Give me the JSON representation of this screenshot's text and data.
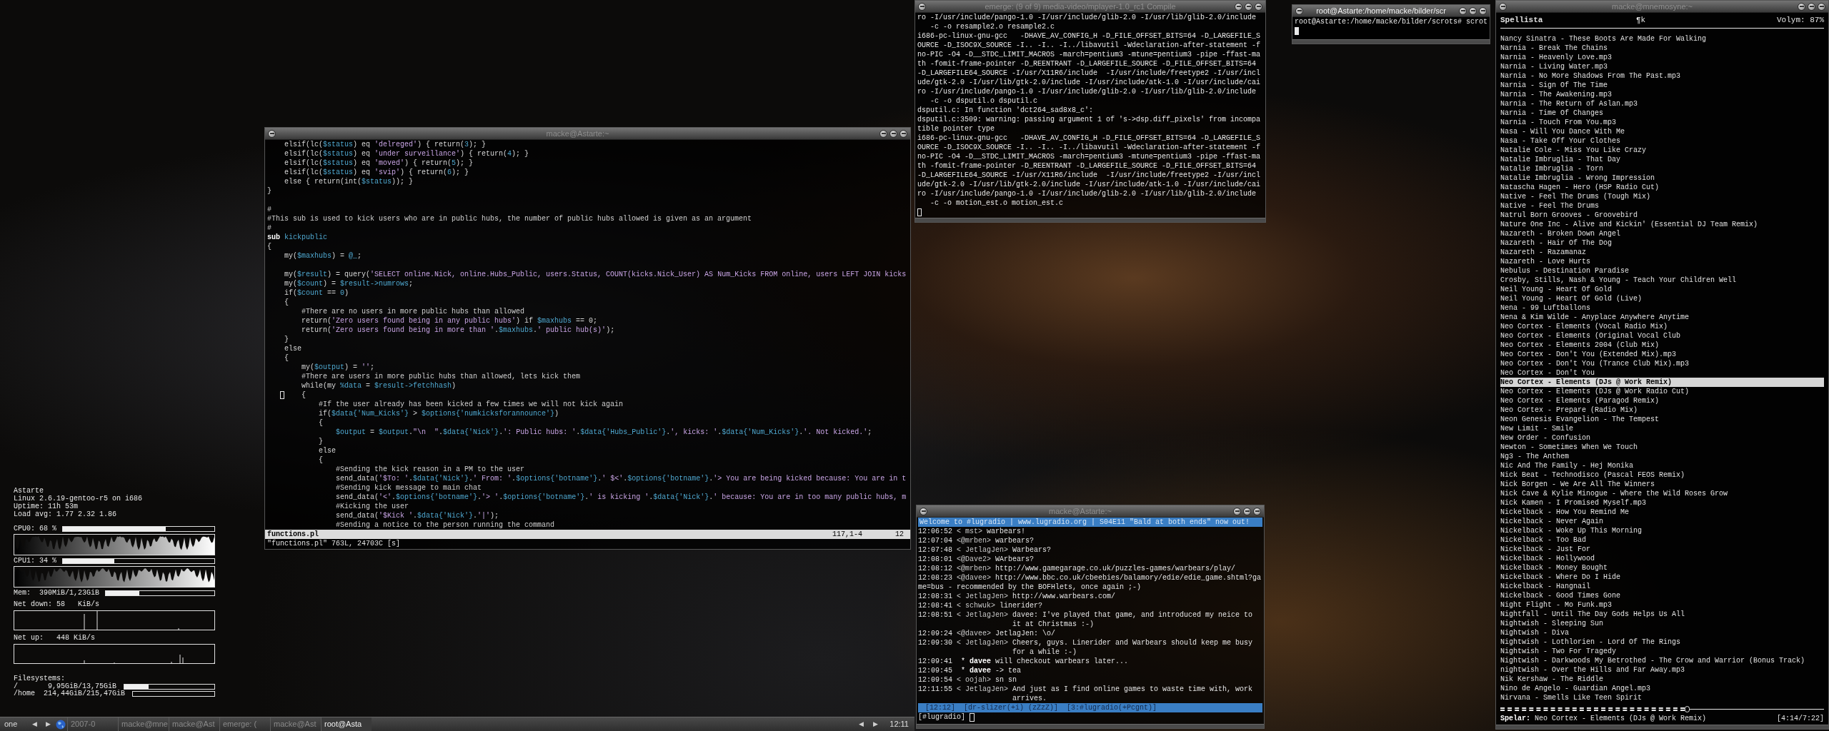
{
  "system_monitor": {
    "lines": [
      "Astarte",
      "Linux 2.6.19-gentoo-r5 on i686",
      "Uptime: 11h 53m",
      "Load avg: 1.77 2.32 1.86"
    ],
    "cpus": [
      {
        "label": "CPU0: 68 %",
        "level": 0.68
      },
      {
        "label": "CPU1: 34 %",
        "level": 0.34
      }
    ],
    "memory": {
      "label": "Mem:  390MiB/1,23GiB",
      "level": 0.31
    },
    "network": [
      {
        "label": "Net down: 58   KiB/s"
      },
      {
        "label": "Net up:   448 KiB/s"
      }
    ],
    "filesystems": {
      "title": "Filesystems:",
      "items": [
        {
          "label": "/       9,95GiB/13,75GiB",
          "level": 0.27
        },
        {
          "label": "/home  214,44GiB/215,47GiB",
          "level": 0
        }
      ]
    }
  },
  "editor": {
    "title": "macke@Astarte:~",
    "focused": false,
    "lines": [
      {
        "kind": "code",
        "segments": [
          {
            "kind": "plain",
            "text": "    elsif(lc("
          },
          {
            "kind": "var",
            "text": "$status"
          },
          {
            "kind": "plain",
            "text": ") eq "
          },
          {
            "kind": "string",
            "text": "'delreged'"
          },
          {
            "kind": "plain",
            "text": ") { return("
          },
          {
            "kind": "number",
            "text": "3"
          },
          {
            "kind": "plain",
            "text": "); }"
          }
        ]
      },
      {
        "kind": "code",
        "segments": [
          {
            "kind": "plain",
            "text": "    elsif(lc("
          },
          {
            "kind": "var",
            "text": "$status"
          },
          {
            "kind": "plain",
            "text": ") eq "
          },
          {
            "kind": "string",
            "text": "'under surveillance'"
          },
          {
            "kind": "plain",
            "text": ") { return("
          },
          {
            "kind": "number",
            "text": "4"
          },
          {
            "kind": "plain",
            "text": "); }"
          }
        ]
      },
      {
        "kind": "code",
        "segments": [
          {
            "kind": "plain",
            "text": "    elsif(lc("
          },
          {
            "kind": "var",
            "text": "$status"
          },
          {
            "kind": "plain",
            "text": ") eq "
          },
          {
            "kind": "string",
            "text": "'moved'"
          },
          {
            "kind": "plain",
            "text": ") { return("
          },
          {
            "kind": "number",
            "text": "5"
          },
          {
            "kind": "plain",
            "text": "); }"
          }
        ]
      },
      {
        "kind": "code",
        "segments": [
          {
            "kind": "plain",
            "text": "    elsif(lc("
          },
          {
            "kind": "var",
            "text": "$status"
          },
          {
            "kind": "plain",
            "text": ") eq "
          },
          {
            "kind": "string",
            "text": "'svip'"
          },
          {
            "kind": "plain",
            "text": ") { return("
          },
          {
            "kind": "number",
            "text": "6"
          },
          {
            "kind": "plain",
            "text": "); }"
          }
        ]
      },
      {
        "kind": "code",
        "segments": [
          {
            "kind": "plain",
            "text": "    else { return(int("
          },
          {
            "kind": "var",
            "text": "$status"
          },
          {
            "kind": "plain",
            "text": ")); }"
          }
        ]
      },
      {
        "kind": "code",
        "segments": [
          {
            "kind": "plain",
            "text": "}"
          }
        ]
      },
      {
        "kind": "blank"
      },
      {
        "kind": "code",
        "segments": [
          {
            "kind": "comment",
            "text": "#"
          }
        ]
      },
      {
        "kind": "code",
        "segments": [
          {
            "kind": "comment",
            "text": "#This sub is used to kick users who are in public hubs, the number of public hubs allowed is given as an argument"
          }
        ]
      },
      {
        "kind": "code",
        "segments": [
          {
            "kind": "comment",
            "text": "#"
          }
        ]
      },
      {
        "kind": "code",
        "segments": [
          {
            "kind": "keyword",
            "text": "sub "
          },
          {
            "kind": "var",
            "text": "kickpublic"
          }
        ]
      },
      {
        "kind": "code",
        "segments": [
          {
            "kind": "plain",
            "text": "{"
          }
        ]
      },
      {
        "kind": "code",
        "segments": [
          {
            "kind": "plain",
            "text": "    my("
          },
          {
            "kind": "var",
            "text": "$maxhubs"
          },
          {
            "kind": "plain",
            "text": ") = "
          },
          {
            "kind": "var",
            "text": "@_"
          },
          {
            "kind": "plain",
            "text": ";"
          }
        ]
      },
      {
        "kind": "blank"
      },
      {
        "kind": "code",
        "segments": [
          {
            "kind": "plain",
            "text": "    my("
          },
          {
            "kind": "var",
            "text": "$result"
          },
          {
            "kind": "plain",
            "text": ") = query("
          },
          {
            "kind": "string",
            "text": "'SELECT online.Nick, online.Hubs_Public, users.Status, COUNT(kicks.Nick_User) AS Num_Kicks FROM online, users LEFT JOIN kicks"
          }
        ]
      },
      {
        "kind": "code",
        "segments": [
          {
            "kind": "plain",
            "text": "    my("
          },
          {
            "kind": "var",
            "text": "$count"
          },
          {
            "kind": "plain",
            "text": ") = "
          },
          {
            "kind": "var",
            "text": "$result->numrows"
          },
          {
            "kind": "plain",
            "text": ";"
          }
        ]
      },
      {
        "kind": "code",
        "segments": [
          {
            "kind": "plain",
            "text": "    if("
          },
          {
            "kind": "var",
            "text": "$count"
          },
          {
            "kind": "plain",
            "text": " == "
          },
          {
            "kind": "number",
            "text": "0"
          },
          {
            "kind": "plain",
            "text": ")"
          }
        ]
      },
      {
        "kind": "code",
        "segments": [
          {
            "kind": "plain",
            "text": "    {"
          }
        ]
      },
      {
        "kind": "code",
        "segments": [
          {
            "kind": "comment",
            "text": "        #There are no users in more public hubs than allowed"
          }
        ]
      },
      {
        "kind": "code",
        "segments": [
          {
            "kind": "plain",
            "text": "        return("
          },
          {
            "kind": "string",
            "text": "'Zero users found being in any public hubs'"
          },
          {
            "kind": "plain",
            "text": ") if "
          },
          {
            "kind": "var",
            "text": "$maxhubs"
          },
          {
            "kind": "plain",
            "text": " == 0;"
          }
        ]
      },
      {
        "kind": "code",
        "segments": [
          {
            "kind": "plain",
            "text": "        return("
          },
          {
            "kind": "string",
            "text": "'Zero users found being in more than '"
          },
          {
            "kind": "plain",
            "text": "."
          },
          {
            "kind": "var",
            "text": "$maxhubs"
          },
          {
            "kind": "plain",
            "text": "."
          },
          {
            "kind": "string",
            "text": "' public hub(s)'"
          },
          {
            "kind": "plain",
            "text": ");"
          }
        ]
      },
      {
        "kind": "code",
        "segments": [
          {
            "kind": "plain",
            "text": "    }"
          }
        ]
      },
      {
        "kind": "code",
        "segments": [
          {
            "kind": "plain",
            "text": "    else"
          }
        ]
      },
      {
        "kind": "code",
        "segments": [
          {
            "kind": "plain",
            "text": "    {"
          }
        ]
      },
      {
        "kind": "code",
        "segments": [
          {
            "kind": "plain",
            "text": "        my("
          },
          {
            "kind": "var",
            "text": "$output"
          },
          {
            "kind": "plain",
            "text": ") = "
          },
          {
            "kind": "string",
            "text": "''"
          },
          {
            "kind": "plain",
            "text": ";"
          }
        ]
      },
      {
        "kind": "code",
        "segments": [
          {
            "kind": "comment",
            "text": "        #There are users in more public hubs than allowed, lets kick them"
          }
        ]
      },
      {
        "kind": "code",
        "segments": [
          {
            "kind": "plain",
            "text": "        while(my "
          },
          {
            "kind": "var",
            "text": "%data"
          },
          {
            "kind": "plain",
            "text": " = "
          },
          {
            "kind": "var",
            "text": "$result->fetchhash"
          },
          {
            "kind": "plain",
            "text": ")"
          }
        ]
      },
      {
        "kind": "code",
        "segments": [
          {
            "kind": "cursor"
          },
          {
            "kind": "plain",
            "text": "    {"
          }
        ]
      },
      {
        "kind": "code",
        "segments": [
          {
            "kind": "comment",
            "text": "            #If the user already has been kicked a few times we will not kick again"
          }
        ]
      },
      {
        "kind": "code",
        "segments": [
          {
            "kind": "plain",
            "text": "            if("
          },
          {
            "kind": "var",
            "text": "$data{'Num_Kicks'}"
          },
          {
            "kind": "plain",
            "text": " > "
          },
          {
            "kind": "var",
            "text": "$options{'numkicksforannounce'}"
          },
          {
            "kind": "plain",
            "text": ")"
          }
        ]
      },
      {
        "kind": "code",
        "segments": [
          {
            "kind": "plain",
            "text": "            {"
          }
        ]
      },
      {
        "kind": "code",
        "segments": [
          {
            "kind": "var",
            "text": "                $output"
          },
          {
            "kind": "plain",
            "text": " = "
          },
          {
            "kind": "var",
            "text": "$output"
          },
          {
            "kind": "plain",
            "text": "."
          },
          {
            "kind": "string",
            "text": "\"\\n  \""
          },
          {
            "kind": "plain",
            "text": "."
          },
          {
            "kind": "var",
            "text": "$data{'Nick'}"
          },
          {
            "kind": "plain",
            "text": "."
          },
          {
            "kind": "string",
            "text": "': Public hubs: '"
          },
          {
            "kind": "plain",
            "text": "."
          },
          {
            "kind": "var",
            "text": "$data{'Hubs_Public'}"
          },
          {
            "kind": "plain",
            "text": "."
          },
          {
            "kind": "string",
            "text": "', kicks: '"
          },
          {
            "kind": "plain",
            "text": "."
          },
          {
            "kind": "var",
            "text": "$data{'Num_Kicks'}"
          },
          {
            "kind": "plain",
            "text": "."
          },
          {
            "kind": "string",
            "text": "'. Not kicked.'"
          },
          {
            "kind": "plain",
            "text": ";"
          }
        ]
      },
      {
        "kind": "code",
        "segments": [
          {
            "kind": "plain",
            "text": "            }"
          }
        ]
      },
      {
        "kind": "code",
        "segments": [
          {
            "kind": "plain",
            "text": "            else"
          }
        ]
      },
      {
        "kind": "code",
        "segments": [
          {
            "kind": "plain",
            "text": "            {"
          }
        ]
      },
      {
        "kind": "code",
        "segments": [
          {
            "kind": "comment",
            "text": "                #Sending the kick reason in a PM to the user"
          }
        ]
      },
      {
        "kind": "code",
        "segments": [
          {
            "kind": "plain",
            "text": "                send_data("
          },
          {
            "kind": "string",
            "text": "'$To: '"
          },
          {
            "kind": "plain",
            "text": "."
          },
          {
            "kind": "var",
            "text": "$data{'Nick'}"
          },
          {
            "kind": "plain",
            "text": "."
          },
          {
            "kind": "string",
            "text": "' From: '"
          },
          {
            "kind": "plain",
            "text": "."
          },
          {
            "kind": "var",
            "text": "$options{'botname'}"
          },
          {
            "kind": "plain",
            "text": "."
          },
          {
            "kind": "string",
            "text": "' $<'"
          },
          {
            "kind": "plain",
            "text": "."
          },
          {
            "kind": "var",
            "text": "$options{'botname'}"
          },
          {
            "kind": "plain",
            "text": "."
          },
          {
            "kind": "string",
            "text": "'> You are being kicked because: You are in t"
          }
        ]
      },
      {
        "kind": "code",
        "segments": [
          {
            "kind": "comment",
            "text": "                #Sending kick message to main chat"
          }
        ]
      },
      {
        "kind": "code",
        "segments": [
          {
            "kind": "plain",
            "text": "                send_data("
          },
          {
            "kind": "string",
            "text": "'<'"
          },
          {
            "kind": "plain",
            "text": "."
          },
          {
            "kind": "var",
            "text": "$options{'botname'}"
          },
          {
            "kind": "plain",
            "text": "."
          },
          {
            "kind": "string",
            "text": "'> '"
          },
          {
            "kind": "plain",
            "text": "."
          },
          {
            "kind": "var",
            "text": "$options{'botname'}"
          },
          {
            "kind": "plain",
            "text": "."
          },
          {
            "kind": "string",
            "text": "' is kicking '"
          },
          {
            "kind": "plain",
            "text": "."
          },
          {
            "kind": "var",
            "text": "$data{'Nick'}"
          },
          {
            "kind": "plain",
            "text": "."
          },
          {
            "kind": "string",
            "text": "' because: You are in too many public hubs, m"
          }
        ]
      },
      {
        "kind": "code",
        "segments": [
          {
            "kind": "comment",
            "text": "                #Kicking the user"
          }
        ]
      },
      {
        "kind": "code",
        "segments": [
          {
            "kind": "plain",
            "text": "                send_data("
          },
          {
            "kind": "string",
            "text": "'$Kick '"
          },
          {
            "kind": "plain",
            "text": "."
          },
          {
            "kind": "var",
            "text": "$data{'Nick'}"
          },
          {
            "kind": "plain",
            "text": "."
          },
          {
            "kind": "string",
            "text": "'|'"
          },
          {
            "kind": "plain",
            "text": ");"
          }
        ]
      },
      {
        "kind": "code",
        "segments": [
          {
            "kind": "comment",
            "text": "                #Sending a notice to the person running the command"
          }
        ]
      }
    ],
    "status_line": {
      "file": "functions.pl",
      "position": "117,1-4",
      "percent": "12"
    },
    "message_line": "\"functions.pl\" 763L, 24703C [s]"
  },
  "compile_terminal": {
    "title": "emerge: (9 of 9) media-video/mplayer-1.0_rc1 Compile",
    "focused": false,
    "lines": [
      "ro -I/usr/include/pango-1.0 -I/usr/include/glib-2.0 -I/usr/lib/glib-2.0/include",
      "   -c -o resample2.o resample2.c",
      "i686-pc-linux-gnu-gcc   -DHAVE_AV_CONFIG_H -D_FILE_OFFSET_BITS=64 -D_LARGEFILE_S",
      "OURCE -D_ISOC9X_SOURCE -I.. -I.. -I../libavutil -Wdeclaration-after-statement -f",
      "no-PIC -O4 -D__STDC_LIMIT_MACROS -march=pentium3 -mtune=pentium3 -pipe -ffast-ma",
      "th -fomit-frame-pointer -D_REENTRANT -D_LARGEFILE_SOURCE -D_FILE_OFFSET_BITS=64",
      "-D_LARGEFILE64_SOURCE -I/usr/X11R6/include  -I/usr/include/freetype2 -I/usr/incl",
      "ude/gtk-2.0 -I/usr/lib/gtk-2.0/include -I/usr/include/atk-1.0 -I/usr/include/cai",
      "ro -I/usr/include/pango-1.0 -I/usr/include/glib-2.0 -I/usr/lib/glib-2.0/include",
      "   -c -o dsputil.o dsputil.c",
      "dsputil.c: In function 'dct264_sad8x8_c':",
      "dsputil.c:3509: warning: passing argument 1 of 's->dsp.diff_pixels' from incompa",
      "tible pointer type",
      "i686-pc-linux-gnu-gcc   -DHAVE_AV_CONFIG_H -D_FILE_OFFSET_BITS=64 -D_LARGEFILE_S",
      "OURCE -D_ISOC9X_SOURCE -I.. -I.. -I../libavutil -Wdeclaration-after-statement -f",
      "no-PIC -O4 -D__STDC_LIMIT_MACROS -march=pentium3 -mtune=pentium3 -pipe -ffast-ma",
      "th -fomit-frame-pointer -D_REENTRANT -D_LARGEFILE_SOURCE -D_FILE_OFFSET_BITS=64",
      "-D_LARGEFILE64_SOURCE -I/usr/X11R6/include  -I/usr/include/freetype2 -I/usr/incl",
      "ude/gtk-2.0 -I/usr/lib/gtk-2.0/include -I/usr/include/atk-1.0 -I/usr/include/cai",
      "ro -I/usr/include/pango-1.0 -I/usr/include/glib-2.0 -I/usr/lib/glib-2.0/include",
      "   -c -o motion_est.o motion_est.c"
    ]
  },
  "shell_terminal": {
    "title": "root@Astarte:/home/macke/bilder/scr",
    "focused": true,
    "lines": [
      "root@Astarte:/home/macke/bilder/scrots# scrot"
    ]
  },
  "irc_window": {
    "title": "macke@Astarte:~",
    "focused": false,
    "topic": "Welcome to #lugradio | www.lugradio.org | S04E11 \"Bald at both ends\" now out!",
    "rows": [
      {
        "kind": "message",
        "time": "12:06:52",
        "nick": "< mst>",
        "lines": [
          "warbears!"
        ]
      },
      {
        "kind": "message",
        "time": "12:07:04",
        "nick": "<@mrben>",
        "lines": [
          "warbears?"
        ]
      },
      {
        "kind": "message",
        "time": "12:07:48",
        "nick": "< JetlagJen>",
        "lines": [
          "Warbears?"
        ]
      },
      {
        "kind": "message",
        "time": "12:08:01",
        "nick": "<@Dave2>",
        "lines": [
          "WArbears?"
        ]
      },
      {
        "kind": "message",
        "time": "12:08:12",
        "nick": "<@mrben>",
        "lines": [
          "http://www.gamegarage.co.uk/puzzles-games/warbears/play/"
        ]
      },
      {
        "kind": "message",
        "time": "12:08:23",
        "nick": "<@davee>",
        "lines": [
          "http://www.bbc.co.uk/cbeebies/balamory/edie/edie_game.shtml?ga"
        ]
      },
      {
        "kind": "wrapped",
        "text": "me=bus - recommended by the BOFHlets, once again ;-)"
      },
      {
        "kind": "message",
        "time": "12:08:31",
        "nick": "< JetlagJen>",
        "lines": [
          "http://www.warbears.com/"
        ]
      },
      {
        "kind": "message",
        "time": "12:08:41",
        "nick": "< schwuk>",
        "lines": [
          "linerider?"
        ]
      },
      {
        "kind": "message",
        "time": "12:08:51",
        "nick": "< JetlagJen>",
        "lines": [
          "davee: I've played that game, and introduced my neice to",
          "it at Christmas :-)"
        ]
      },
      {
        "kind": "message",
        "time": "12:09:24",
        "nick": "<@davee>",
        "lines": [
          "JetlagJen: \\o/"
        ]
      },
      {
        "kind": "message",
        "time": "12:09:30",
        "nick": "< JetlagJen>",
        "lines": [
          "Cheers, guys. Linerider and Warbears should keep me busy",
          "for a while :-)"
        ]
      },
      {
        "kind": "action",
        "time": "12:09:41",
        "marker": "*",
        "nick": "davee",
        "text": "will checkout warbears later..."
      },
      {
        "kind": "action",
        "time": "12:09:45",
        "marker": "*",
        "nick": "davee",
        "text": "-> tea"
      },
      {
        "kind": "message",
        "time": "12:09:54",
        "nick": "< oojah>",
        "lines": [
          "sn sn"
        ]
      },
      {
        "kind": "message",
        "time": "12:11:55",
        "nick": "< JetlagJen>",
        "lines": [
          "And just as I find online games to waste time with, work",
          "arrives."
        ]
      }
    ],
    "status_items": [
      "[12:12]",
      "[dr-slizer(+i) (zZzZ)]",
      "[3:#lugradio(+Pcgnt)]"
    ],
    "prompt": "[#lugradio]"
  },
  "playlist": {
    "title": "macke@mnemosyne:~",
    "focused": false,
    "heading": "Spellista",
    "indicator": "¶k",
    "volume": "Volym: 87%",
    "items": [
      {
        "text": "Nancy Sinatra - These Boots Are Made For Walking",
        "selected": false
      },
      {
        "text": "Narnia - Break The Chains",
        "selected": false
      },
      {
        "text": "Narnia - Heavenly Love.mp3",
        "selected": false
      },
      {
        "text": "Narnia - Living Water.mp3",
        "selected": false
      },
      {
        "text": "Narnia - No More Shadows From The Past.mp3",
        "selected": false
      },
      {
        "text": "Narnia - Sign Of The Time",
        "selected": false
      },
      {
        "text": "Narnia - The Awakening.mp3",
        "selected": false
      },
      {
        "text": "Narnia - The Return of Aslan.mp3",
        "selected": false
      },
      {
        "text": "Narnia - Time Of Changes",
        "selected": false
      },
      {
        "text": "Narnia - Touch From You.mp3",
        "selected": false
      },
      {
        "text": "Nasa - Will You Dance With Me",
        "selected": false
      },
      {
        "text": "Nasa - Take Off Your Clothes",
        "selected": false
      },
      {
        "text": "Natalie Cole - Miss You Like Crazy",
        "selected": false
      },
      {
        "text": "Natalie Imbruglia - That Day",
        "selected": false
      },
      {
        "text": "Natalie Imbruglia - Torn",
        "selected": false
      },
      {
        "text": "Natalie Imbruglia - Wrong Impression",
        "selected": false
      },
      {
        "text": "Natascha Hagen - Hero (HSP Radio Cut)",
        "selected": false
      },
      {
        "text": "Native - Feel The Drums (Tough Mix)",
        "selected": false
      },
      {
        "text": "Native - Feel The Drums",
        "selected": false
      },
      {
        "text": "Natrul Born Grooves - Groovebird",
        "selected": false
      },
      {
        "text": "Nature One Inc - Alive and Kickin' (Essential DJ Team Remix)",
        "selected": false
      },
      {
        "text": "Nazareth - Broken Down Angel",
        "selected": false
      },
      {
        "text": "Nazareth - Hair Of The Dog",
        "selected": false
      },
      {
        "text": "Nazareth - Razamanaz",
        "selected": false
      },
      {
        "text": "Nazareth - Love Hurts",
        "selected": false
      },
      {
        "text": "Nebulus - Destination Paradise",
        "selected": false
      },
      {
        "text": "Crosby, Stills, Nash & Young - Teach Your Children Well",
        "selected": false
      },
      {
        "text": "Neil Young - Heart Of Gold",
        "selected": false
      },
      {
        "text": "Neil Young - Heart Of Gold (Live)",
        "selected": false
      },
      {
        "text": "Nena - 99 Luftballons",
        "selected": false
      },
      {
        "text": "Nena & Kim Wilde - Anyplace Anywhere Anytime",
        "selected": false
      },
      {
        "text": "Neo Cortex - Elements (Vocal Radio Mix)",
        "selected": false
      },
      {
        "text": "Neo Cortex - Elements (Original Vocal Club",
        "selected": false
      },
      {
        "text": "Neo Cortex - Elements 2004 (Club Mix)",
        "selected": false
      },
      {
        "text": "Neo Cortex - Don't You (Extended Mix).mp3",
        "selected": false
      },
      {
        "text": "Neo Cortex - Don't You (Trance Club Mix).mp3",
        "selected": false
      },
      {
        "text": "Neo Cortex - Don't You",
        "selected": false
      },
      {
        "text": "Neo Cortex - Elements (DJs @ Work Remix)",
        "selected": true
      },
      {
        "text": "Neo Cortex - Elements (DJs @ Work Radio Cut)",
        "selected": false
      },
      {
        "text": "Neo Cortex - Elements (Paragod Remix)",
        "selected": false
      },
      {
        "text": "Neo Cortex - Prepare (Radio Mix)",
        "selected": false
      },
      {
        "text": "Neon Genesis Evangelion - The Tempest",
        "selected": false
      },
      {
        "text": "New Limit - Smile",
        "selected": false
      },
      {
        "text": "New Order - Confusion",
        "selected": false
      },
      {
        "text": "Newton - Sometimes When We Touch",
        "selected": false
      },
      {
        "text": "Ng3 - The Anthem",
        "selected": false
      },
      {
        "text": "Nic And The Family - Hej Monika",
        "selected": false
      },
      {
        "text": "Nick Beat - Technodisco (Pascal FEOS Remix)",
        "selected": false
      },
      {
        "text": "Nick Borgen - We Are All The Winners",
        "selected": false
      },
      {
        "text": "Nick Cave & Kylie Minogue - Where the Wild Roses Grow",
        "selected": false
      },
      {
        "text": "Nick Kamen - I Promised Myself.mp3",
        "selected": false
      },
      {
        "text": "Nickelback - How You Remind Me",
        "selected": false
      },
      {
        "text": "Nickelback - Never Again",
        "selected": false
      },
      {
        "text": "Nickelback - Woke Up This Morning",
        "selected": false
      },
      {
        "text": "Nickelback - Too Bad",
        "selected": false
      },
      {
        "text": "Nickelback - Just For",
        "selected": false
      },
      {
        "text": "Nickelback - Hollywood",
        "selected": false
      },
      {
        "text": "Nickelback - Money Bought",
        "selected": false
      },
      {
        "text": "Nickelback - Where Do I Hide",
        "selected": false
      },
      {
        "text": "Nickelback - Hangnail",
        "selected": false
      },
      {
        "text": "Nickelback - Good Times Gone",
        "selected": false
      },
      {
        "text": "Night Flight - Mo Funk.mp3",
        "selected": false
      },
      {
        "text": "Nightfall - Until The Day Gods Helps Us All",
        "selected": false
      },
      {
        "text": "Nightwish - Sleeping Sun",
        "selected": false
      },
      {
        "text": "Nightwish - Diva",
        "selected": false
      },
      {
        "text": "Nightwish - Lothlorien - Lord Of The Rings",
        "selected": false
      },
      {
        "text": "Nightwish - Two For Tragedy",
        "selected": false
      },
      {
        "text": "Nightwish - Darkwoods My Betrothed - The Crow and Warrior (Bonus Track)",
        "selected": false
      },
      {
        "text": "nightwish - Over the Hills and Far Away.mp3",
        "selected": false
      },
      {
        "text": "Nik Kershaw - The Riddle",
        "selected": false
      },
      {
        "text": "Nino de Angelo - Guardian Angel.mp3",
        "selected": false
      },
      {
        "text": "Nirvana - Smells Like Teen Spirit",
        "selected": false
      }
    ],
    "progress": {
      "level": 0.57
    },
    "now_playing": {
      "label": "Spelar:",
      "track": "Neo Cortex - Elements (DJs @ Work Remix)",
      "time": "[4:14/7:22]"
    }
  },
  "taskbar": {
    "desktop": "one",
    "prev": "◀",
    "next": "▶",
    "tasks": [
      {
        "label": "2007-0",
        "selected": false
      },
      {
        "label": "macke@mne",
        "selected": false
      },
      {
        "label": "macke@Ast",
        "selected": false
      },
      {
        "label": "emerge: (",
        "selected": false
      },
      {
        "label": "macke@Ast",
        "selected": false
      },
      {
        "label": "root@Asta",
        "selected": true
      }
    ],
    "tray_prev": "◀",
    "tray_next": "▶",
    "clock": "12:11"
  }
}
